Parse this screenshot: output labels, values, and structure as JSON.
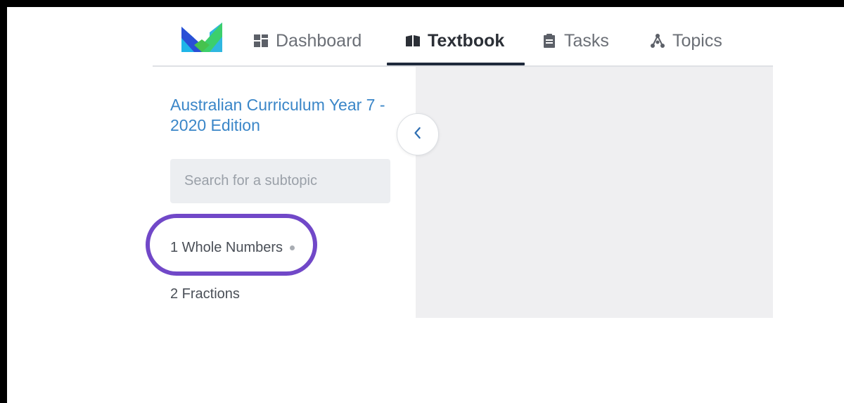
{
  "nav": {
    "items": [
      {
        "label": "Dashboard",
        "icon": "dashboard-icon",
        "active": false
      },
      {
        "label": "Textbook",
        "icon": "book-icon",
        "active": true
      },
      {
        "label": "Tasks",
        "icon": "clipboard-icon",
        "active": false
      },
      {
        "label": "Topics",
        "icon": "topics-network-icon",
        "active": false
      }
    ]
  },
  "sidebar": {
    "course_title": "Australian Curriculum Year 7 - 2020 Edition",
    "search_placeholder": "Search for a subtopic",
    "topics": [
      {
        "label": "1 Whole Numbers",
        "highlighted": true
      },
      {
        "label": "2 Fractions",
        "highlighted": false
      }
    ]
  },
  "colors": {
    "accent": "#3a86c8",
    "highlight": "#7148c8",
    "active_underline": "#1f2a3c",
    "content_bg": "#efeff1"
  }
}
